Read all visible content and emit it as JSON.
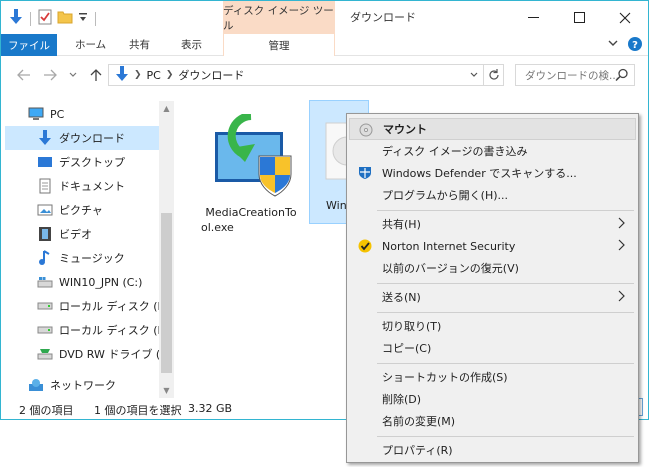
{
  "window": {
    "title": "ダウンロード",
    "contextual_tab_group": "ディスク イメージ ツール",
    "accent_color": "#1979ca",
    "contextual_color": "#fadbc6"
  },
  "ribbon": {
    "file_tab": "ファイル",
    "tabs": [
      "ホーム",
      "共有",
      "表示"
    ],
    "manage_tab": "管理"
  },
  "address": {
    "path": [
      "PC",
      "ダウンロード"
    ],
    "search_placeholder": "ダウンロードの検..."
  },
  "nav": {
    "items": [
      {
        "label": "PC",
        "icon": "pc-icon"
      },
      {
        "label": "ダウンロード",
        "icon": "download-icon",
        "selected": true
      },
      {
        "label": "デスクトップ",
        "icon": "desktop-icon"
      },
      {
        "label": "ドキュメント",
        "icon": "document-icon"
      },
      {
        "label": "ピクチャ",
        "icon": "pictures-icon"
      },
      {
        "label": "ビデオ",
        "icon": "video-icon"
      },
      {
        "label": "ミュージック",
        "icon": "music-icon"
      },
      {
        "label": "WIN10_JPN (C:)",
        "icon": "windows-drive-icon"
      },
      {
        "label": "ローカル ディスク (D:)",
        "icon": "drive-icon"
      },
      {
        "label": "ローカル ディスク (E:)",
        "icon": "drive-icon"
      },
      {
        "label": "DVD RW ドライブ (F:)",
        "icon": "dvd-drive-icon"
      },
      {
        "label": "ネットワーク",
        "icon": "network-icon"
      }
    ]
  },
  "files": [
    {
      "name": "MediaCreationTool.exe",
      "line1": "MediaCreationTo",
      "line2": "ol.exe",
      "icon": "installer-icon"
    },
    {
      "name": "Win",
      "line1": "Win",
      "icon": "disc-image-icon",
      "selected": true
    }
  ],
  "status": {
    "item_count": "2 個の項目",
    "selection": "1 個の項目を選択",
    "size": "3.32 GB"
  },
  "context_menu": {
    "mount": "マウント",
    "burn": "ディスク イメージの書き込み",
    "defender": "Windows Defender でスキャンする...",
    "open_with": "プログラムから開く(H)...",
    "share": "共有(H)",
    "norton": "Norton Internet Security",
    "restore": "以前のバージョンの復元(V)",
    "send_to": "送る(N)",
    "cut": "切り取り(T)",
    "copy": "コピー(C)",
    "shortcut": "ショートカットの作成(S)",
    "delete": "削除(D)",
    "rename": "名前の変更(M)",
    "properties": "プロパティ(R)"
  }
}
